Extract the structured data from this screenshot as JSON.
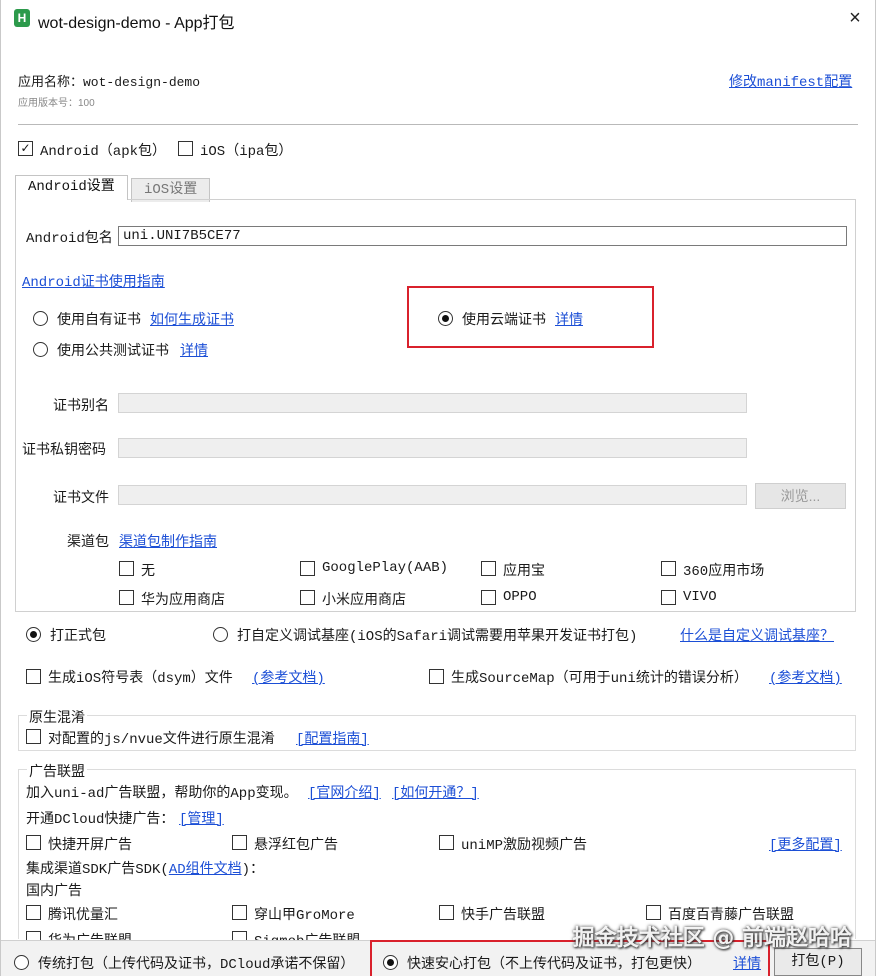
{
  "window": {
    "title": "wot-design-demo - App打包",
    "logo": "H",
    "close": "×"
  },
  "app": {
    "name_label": "应用名称：wot-design-demo",
    "version_label": "应用版本号：100",
    "manifest_link": "修改manifest配置"
  },
  "platforms": {
    "android": "Android（apk包）",
    "ios": "iOS（ipa包）"
  },
  "tabs": {
    "android": "Android设置",
    "ios": "iOS设置"
  },
  "android": {
    "package_label": "Android包名",
    "package_value": "uni.UNI7B5CE77",
    "cert_guide": "Android证书使用指南",
    "own_cert": "使用自有证书",
    "how_generate": "如何生成证书",
    "public_cert": "使用公共测试证书",
    "detail": "详情",
    "cloud_cert": "使用云端证书",
    "cloud_detail": "详情",
    "alias_label": "证书别名",
    "password_label": "证书私钥密码",
    "file_label": "证书文件",
    "browse": "浏览...",
    "channel_label": "渠道包",
    "channel_guide": "渠道包制作指南",
    "channels": [
      "无",
      "GooglePlay(AAB)",
      "应用宝",
      "360应用市场",
      "华为应用商店",
      "小米应用商店",
      "OPPO",
      "VIVO"
    ]
  },
  "build": {
    "formal": "打正式包",
    "custom_base": "打自定义调试基座(iOS的Safari调试需要用苹果开发证书打包)",
    "what_custom": "什么是自定义调试基座？",
    "ios_dsym": "生成iOS符号表（dsym）文件",
    "ref_doc1": "(参考文档)",
    "sourcemap": "生成SourceMap（可用于uni统计的错误分析）",
    "ref_doc2": "(参考文档)"
  },
  "obfuscation": {
    "title": "原生混淆",
    "option": "对配置的js/nvue文件进行原生混淆",
    "guide": "[配置指南]"
  },
  "ads": {
    "title": "广告联盟",
    "join_text": "加入uni-ad广告联盟，帮助你的App变现。",
    "official": "[官网介绍]",
    "how_open": "[如何开通？]",
    "dcloud_label": "开通DCloud快捷广告：",
    "manage": "[管理]",
    "splash": "快捷开屏广告",
    "float_red": "悬浮红包广告",
    "unimp_video": "uniMP激励视频广告",
    "more_config": "[更多配置]",
    "sdk_label": "集成渠道SDK广告SDK(",
    "ad_doc": "AD组件文档",
    "sdk_suffix": ")：",
    "domestic": "国内广告",
    "tencent": "腾讯优量汇",
    "gromore": "穿山甲GroMore",
    "kuaishou": "快手广告联盟",
    "baidu": "百度百青藤广告联盟",
    "hw_ads": "华为广告联盟",
    "sigmob": "Sigmob广告联盟"
  },
  "footer": {
    "traditional": "传统打包（上传代码及证书，DCloud承诺不保留）",
    "fast_safe": "快速安心打包（不上传代码及证书，打包更快）",
    "detail": "详情",
    "pack_button": "打包(P)"
  },
  "watermark": "掘金技术社区 @ 前端赵哈哈",
  "colors": {
    "link": "#1c4fd6",
    "highlight": "#d9212c",
    "logo": "#2c9a4b"
  }
}
